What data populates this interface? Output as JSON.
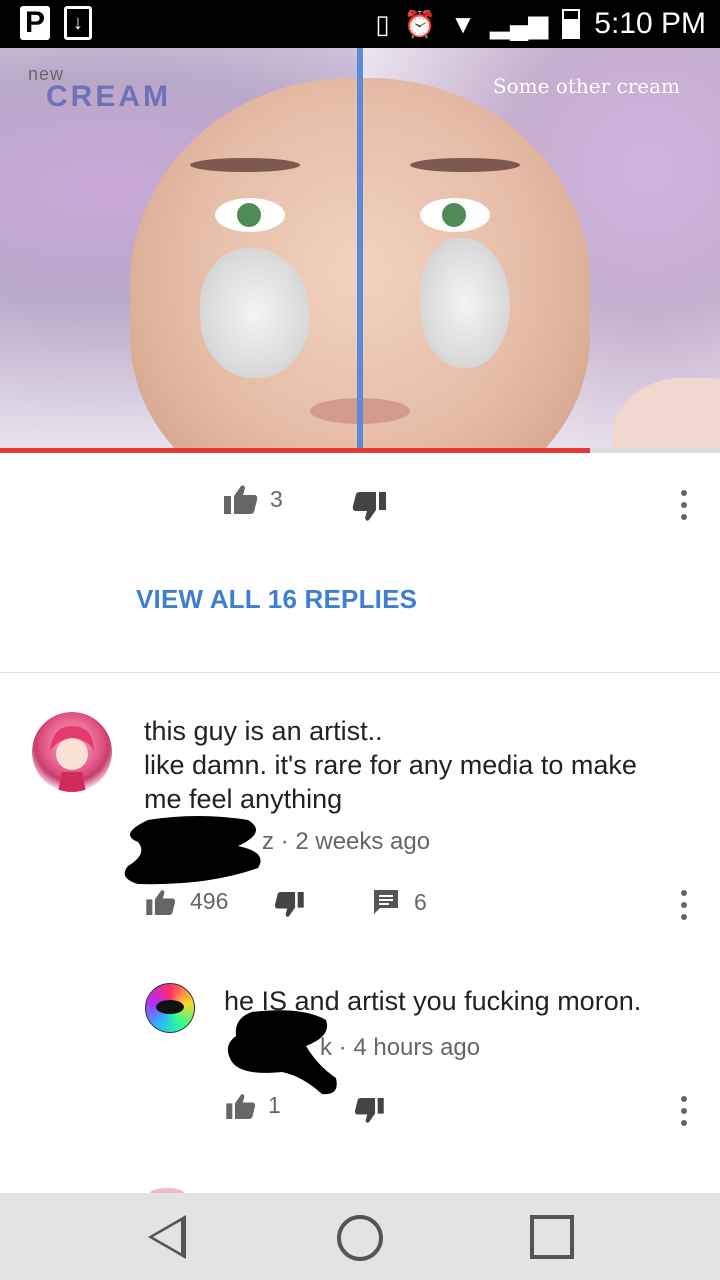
{
  "status_bar": {
    "time": "5:10 PM",
    "left_icons": [
      "pandora-icon",
      "download-icon"
    ],
    "right_icons": [
      "vibrate-icon",
      "alarm-icon",
      "wifi-icon",
      "signal-icon",
      "battery-icon"
    ]
  },
  "video": {
    "logo_small": "new",
    "logo_brand": "CREAM",
    "right_label": "Some other cream",
    "progress_fraction": 0.82
  },
  "parent_comment_actions": {
    "like_count": "3"
  },
  "view_replies_label": "VIEW ALL 16 REPLIES",
  "comments": [
    {
      "text_lines": [
        "this guy is an artist..",
        "like damn. it's rare for any media to make",
        "me feel anything"
      ],
      "author_fragment": "z",
      "time": "2 weeks ago",
      "like_count": "496",
      "reply_count": "6"
    },
    {
      "text": "he IS and artist you fucking moron.",
      "author_fragment": "k",
      "time": "4 hours ago",
      "like_count": "1"
    }
  ],
  "colors": {
    "accent_blue": "#3f7fd0",
    "progress_red": "#e53935",
    "nav_bar": "#e3e3e3"
  }
}
